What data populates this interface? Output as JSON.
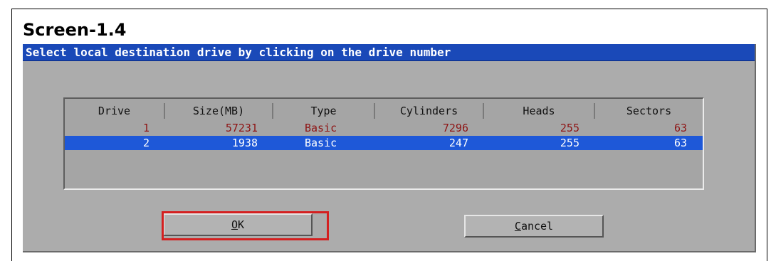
{
  "screen_title": "Screen-1.4",
  "dialog": {
    "title": "Select local destination drive by clicking on the drive number"
  },
  "table": {
    "columns": [
      "Drive",
      "Size(MB)",
      "Type",
      "Cylinders",
      "Heads",
      "Sectors"
    ],
    "rows": [
      {
        "drive": "1",
        "size": "57231",
        "type": "Basic",
        "cylinders": "7296",
        "heads": "255",
        "sectors": "63",
        "selected": false
      },
      {
        "drive": "2",
        "size": "1938",
        "type": "Basic",
        "cylinders": "247",
        "heads": "255",
        "sectors": "63",
        "selected": true
      }
    ]
  },
  "buttons": {
    "ok_label": "OK",
    "ok_mnemonic": "O",
    "ok_rest": "K",
    "cancel_label": "Cancel",
    "cancel_mnemonic": "C",
    "cancel_rest": "ancel"
  },
  "colors": {
    "titlebar": "#1a49b8",
    "dialog_bg": "#acacac",
    "selected_row": "#1e58d8",
    "unselected_row_text": "#8e1414",
    "highlight_box": "#d42020"
  }
}
